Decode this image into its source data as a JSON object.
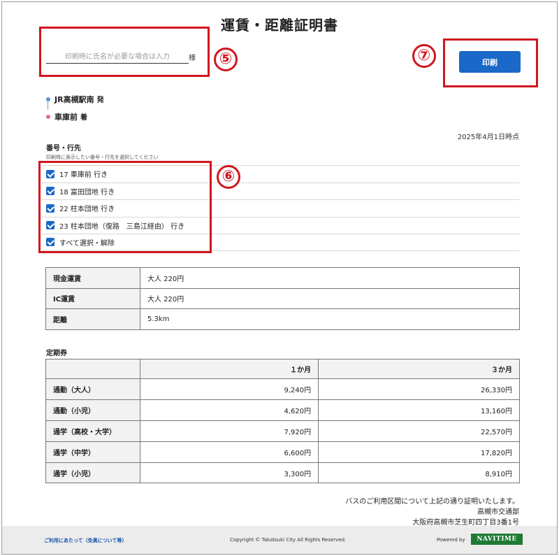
{
  "page": {
    "title": "運賃・距離証明書"
  },
  "name_field": {
    "placeholder": "印刷時に氏名が必要な場合は入力",
    "suffix": "様"
  },
  "print_button": {
    "label": "印刷"
  },
  "annotations": {
    "name": "⑤",
    "routes": "⑥",
    "print": "⑦",
    "color": "#d0161e"
  },
  "route": {
    "origin": {
      "name": "JR高槻駅南",
      "suffix": "発",
      "dot_color": "#5b93d6"
    },
    "destination": {
      "name": "車庫前",
      "suffix": "着",
      "dot_color": "#e0708a"
    }
  },
  "as_of": "2025年4月1日時点",
  "lines_section": {
    "label": "番号・行先",
    "hint": "印刷時に表示したい番号・行先を選択してください",
    "items": [
      {
        "label": "17 車庫前 行き",
        "checked": true
      },
      {
        "label": "18 富田団地 行き",
        "checked": true
      },
      {
        "label": "22 柱本団地 行き",
        "checked": true
      },
      {
        "label": "23 柱本団地（復路　三島江経由） 行き",
        "checked": true
      },
      {
        "label": "すべて選択・解除",
        "checked": true
      }
    ]
  },
  "fares": [
    {
      "label": "現金運賃",
      "value": "大人 220円"
    },
    {
      "label": "IC運賃",
      "value": "大人 220円"
    },
    {
      "label": "距離",
      "value": "5.3km"
    }
  ],
  "commuter_pass": {
    "label": "定期券",
    "columns": [
      "１か月",
      "３か月"
    ],
    "rows": [
      {
        "label": "通勤（大人）",
        "one_month": "9,240円",
        "three_month": "26,330円"
      },
      {
        "label": "通勤（小児）",
        "one_month": "4,620円",
        "three_month": "13,160円"
      },
      {
        "label": "通学（高校・大学）",
        "one_month": "7,920円",
        "three_month": "22,570円"
      },
      {
        "label": "通学（中学）",
        "one_month": "6,600円",
        "three_month": "17,820円"
      },
      {
        "label": "通学（小児）",
        "one_month": "3,300円",
        "three_month": "8,910円"
      }
    ]
  },
  "certification": {
    "statement": "バスのご利用区間について上記の通り証明いたします。",
    "issuer": "高槻市交通部",
    "address": "大阪府高槻市芝生町四丁目3番1号"
  },
  "footer": {
    "link": "ご利用にあたって（免責について等）",
    "copyright": "Copyright © Takatsuki City All Rights Reserved.",
    "powered_by": "Powered by",
    "logo_text": "NAVITIME",
    "logo_color": "#1f7a33"
  },
  "colors": {
    "primary": "#1a68c7"
  }
}
